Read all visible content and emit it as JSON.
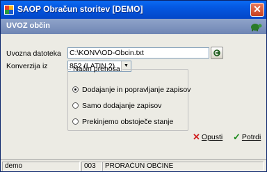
{
  "window": {
    "title": "SAOP  Obračun storitev  [DEMO]",
    "close_glyph": "✕",
    "app_icon": "saop-logo-icon"
  },
  "panel": {
    "title": "UVOZ občin",
    "icon": "turtle-icon"
  },
  "form": {
    "file_label": "Uvozna datoteka",
    "file_value": "C:\\KONV\\OD-Obcin.txt",
    "conversion_label": "Konverzija iz",
    "conversion_value": "852 (LATIN 2)"
  },
  "group": {
    "legend": "Način prenosa",
    "options": [
      {
        "label": "Dodajanje in popravljanje zapisov",
        "selected": true
      },
      {
        "label": "Samo dodajanje zapisov",
        "selected": false
      },
      {
        "label": "Prekinjemo obstoječe stanje",
        "selected": false
      }
    ]
  },
  "actions": {
    "cancel_label": "Opusti",
    "confirm_label": "Potrdi",
    "cancel_color": "#d02020",
    "confirm_color": "#1a8a1a"
  },
  "status": {
    "user": "demo",
    "code": "003",
    "module": "PRORAČUN OBČINE"
  }
}
